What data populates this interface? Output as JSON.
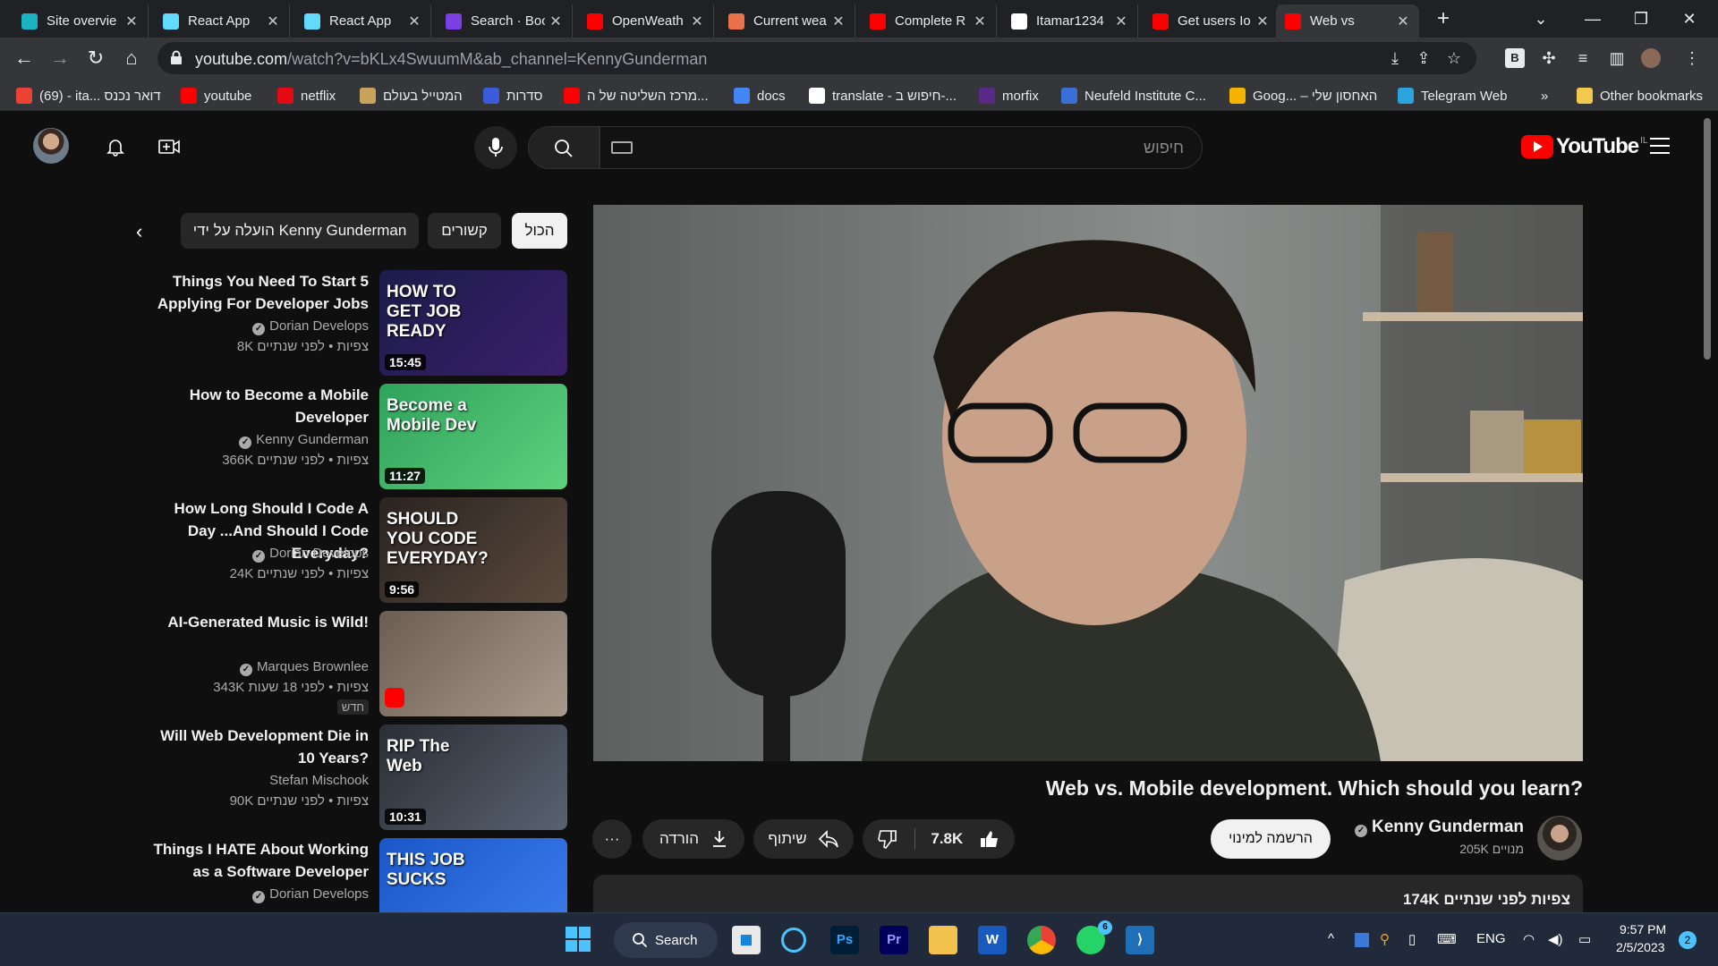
{
  "browser": {
    "tabs": [
      {
        "label": "Site overvie",
        "favicon_color": "#1bb3c1"
      },
      {
        "label": "React App",
        "favicon_color": "#61dafb"
      },
      {
        "label": "React App",
        "favicon_color": "#61dafb"
      },
      {
        "label": "Search · Boo",
        "favicon_color": "#7b3fe4"
      },
      {
        "label": "OpenWeath",
        "favicon_color": "#ff0000"
      },
      {
        "label": "Current wea",
        "favicon_color": "#e8734a"
      },
      {
        "label": "Complete R",
        "favicon_color": "#ff0000"
      },
      {
        "label": "Itamar1234",
        "favicon_color": "#ffffff"
      },
      {
        "label": "Get users Io",
        "favicon_color": "#ff0000"
      },
      {
        "label": "Web vs",
        "favicon_color": "#ff0000",
        "active": true
      }
    ],
    "new_tab": "+",
    "url_host": "youtube.com",
    "url_path": "/watch?v=bKLx4SwuumM&ab_channel=KennyGunderman",
    "bookmarks": [
      {
        "label": "(69) - ita... דואר נכנס",
        "color": "#ea4335"
      },
      {
        "label": "youtube",
        "color": "#ff0000"
      },
      {
        "label": "netflix",
        "color": "#e50914"
      },
      {
        "label": "המטייל בעולם",
        "color": "#c9a35b"
      },
      {
        "label": "סדרות",
        "color": "#3b5bdb"
      },
      {
        "label": "מרכז השליטה של ה...",
        "color": "#ff0000"
      },
      {
        "label": "docs",
        "color": "#4285f4"
      },
      {
        "label": "translate - חיפוש ב-...",
        "color": "#ffffff"
      },
      {
        "label": "morfix",
        "color": "#5b2a86"
      },
      {
        "label": "Neufeld Institute C...",
        "color": "#3a6fd8"
      },
      {
        "label": "Goog... – האחסון שלי",
        "color": "#f4b400"
      },
      {
        "label": "Telegram Web",
        "color": "#2aa3df"
      }
    ],
    "bookmarks_overflow": "»",
    "other_bookmarks": "Other bookmarks"
  },
  "masthead": {
    "search_placeholder": "חיפוש",
    "logo_text": "YouTube",
    "country_code": "IL"
  },
  "sidebar": {
    "chips": [
      "הכול",
      "קשורים",
      "הועלה על ידי Kenny Gunderman"
    ],
    "recommendations": [
      {
        "title": "Things You Need To Start 5 Applying For Developer Jobs",
        "channel": "Dorian Develops",
        "verified": true,
        "meta": "8K צפיות • לפני שנתיים",
        "duration": "15:45",
        "thumb_text": "HOW TO GET JOB READY",
        "thumb_colors": [
          "#1b1c4a",
          "#3a1f6a"
        ]
      },
      {
        "title": "How to Become a Mobile Developer",
        "channel": "Kenny Gunderman",
        "verified": true,
        "meta": "366K צפיות • לפני שנתיים",
        "duration": "11:27",
        "thumb_text": "Become a Mobile Dev",
        "thumb_colors": [
          "#2fa35c",
          "#5fd07d"
        ]
      },
      {
        "title": "How Long Should I Code A Day ...And Should I Code Everyday?",
        "channel": "Dorian Develops",
        "verified": true,
        "meta": "24K צפיות • לפני שנתיים",
        "duration": "9:56",
        "thumb_text": "SHOULD YOU CODE EVERYDAY?",
        "thumb_colors": [
          "#2a2320",
          "#5a4a3d"
        ]
      },
      {
        "title": "AI-Generated Music is Wild!",
        "channel": "Marques Brownlee",
        "verified": true,
        "meta": "343K צפיות • לפני 18 שעות",
        "new_badge": "חדש",
        "duration": "",
        "thumb_text": "",
        "thumb_colors": [
          "#6a5d52",
          "#a89a8b"
        ]
      },
      {
        "title": "Will Web Development Die in 10 Years?",
        "channel": "Stefan Mischook",
        "verified": false,
        "meta": "90K צפיות • לפני שנתיים",
        "duration": "10:31",
        "thumb_text": "RIP The Web",
        "thumb_colors": [
          "#2a2f36",
          "#596270"
        ]
      },
      {
        "title": "Things I HATE About Working as a Software Developer",
        "channel": "Dorian Develops",
        "verified": true,
        "meta": "",
        "duration": "",
        "thumb_text": "THIS JOB SUCKS",
        "thumb_colors": [
          "#1a56c7",
          "#3a7be8"
        ]
      }
    ]
  },
  "video": {
    "title": "Web vs. Mobile development. Which should you learn?",
    "channel": "Kenny Gunderman",
    "subscribers": "205K מנויים",
    "subscribe_label": "הרשמה למינוי",
    "likes": "7.8K",
    "share_label": "שיתוף",
    "download_label": "הורדה",
    "more_label": "···",
    "views_date": "174K צפיות  לפני שנתיים"
  },
  "taskbar": {
    "search_label": "Search",
    "language": "ENG",
    "time": "9:57 PM",
    "date": "2/5/2023",
    "notification_count": "2",
    "whatsapp_badge": "6"
  }
}
